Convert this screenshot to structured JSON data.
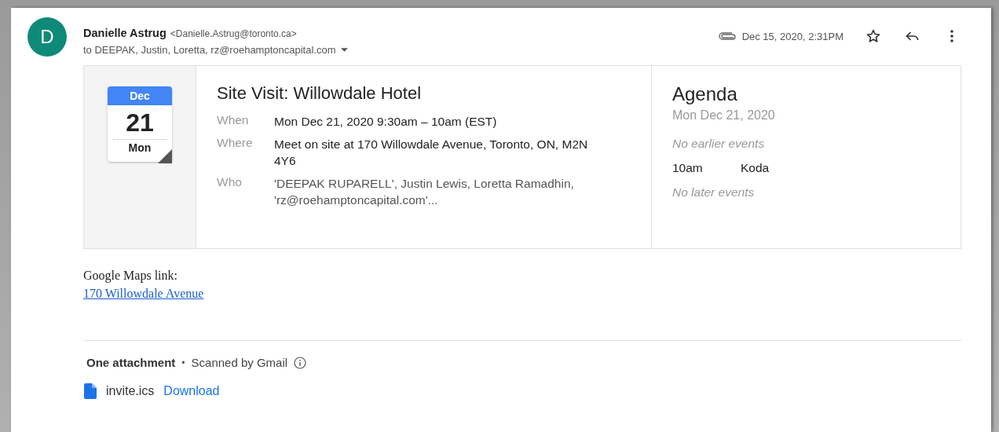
{
  "sender": {
    "avatar_letter": "D",
    "name": "Danielle Astrug",
    "email": "<Danielle.Astrug@toronto.ca>",
    "recipients": "to DEEPAK, Justin, Loretta, rz@roehamptoncapital.com"
  },
  "date": "Dec 15, 2020, 2:31PM",
  "event": {
    "month": "Dec",
    "day": "21",
    "weekday": "Mon",
    "title": "Site Visit: Willowdale Hotel",
    "details": [
      {
        "label": "When",
        "value": "Mon Dec 21, 2020 9:30am – 10am (EST)"
      },
      {
        "label": "Where",
        "value": "Meet on site at 170 Willowdale Avenue, Toronto, ON, M2N 4Y6"
      },
      {
        "label": "Who",
        "value": "'DEEPAK RUPARELL', Justin Lewis, Loretta Ramadhin, 'rz@roehamptoncapital.com'..."
      }
    ]
  },
  "agenda": {
    "title": "Agenda",
    "date": "Mon Dec 21, 2020",
    "items": [
      {
        "kind": "note",
        "text": "No earlier events"
      },
      {
        "kind": "event",
        "time": "10am",
        "title": "Koda"
      },
      {
        "kind": "note",
        "text": "No later events"
      }
    ]
  },
  "body": {
    "label": "Google Maps link:",
    "link": "170 Willowdale Avenue"
  },
  "attachments": {
    "heading": "One attachment",
    "separator": "•",
    "scanned": "Scanned by Gmail",
    "files": [
      {
        "name": "invite.ics",
        "action": "Download"
      }
    ]
  }
}
